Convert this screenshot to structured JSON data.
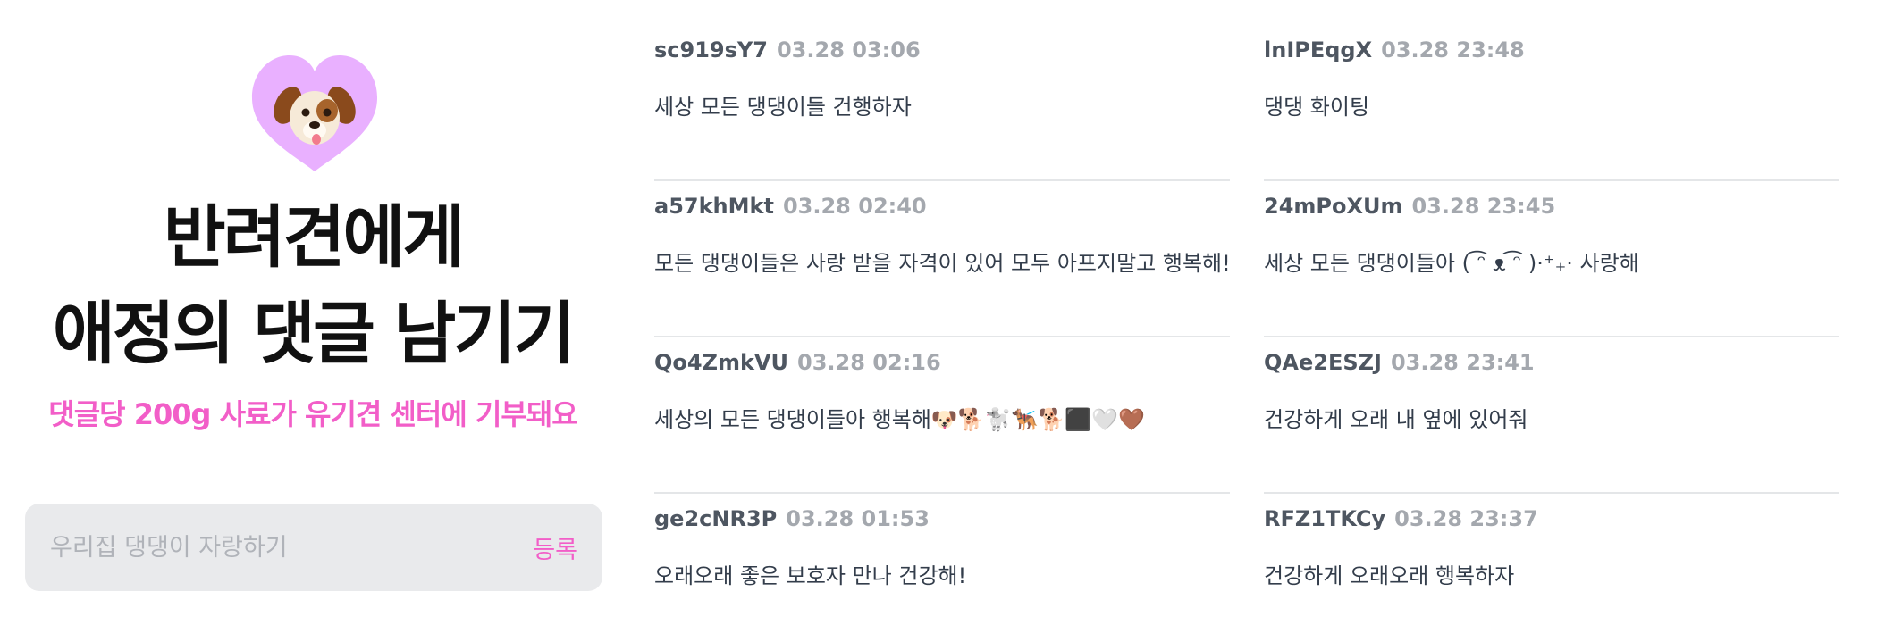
{
  "hero": {
    "icon": "dog-face-icon",
    "title_line1": "반려견에게",
    "title_line2": "애정의 댓글 남기기",
    "subtitle": "댓글당 200g 사료가 유기견 센터에 기부돼요"
  },
  "form": {
    "placeholder": "우리집 댕댕이 자랑하기",
    "submit_label": "등록"
  },
  "colors": {
    "accent": "#f25ec8",
    "heart": "#e9b0ff"
  },
  "comments": {
    "left": [
      {
        "user": "sc919sY7",
        "time": "03.28 03:06",
        "text": "세상 모든 댕댕이들 건행하자"
      },
      {
        "user": "a57khMkt",
        "time": "03.28 02:40",
        "text": "모든 댕댕이들은 사랑 받을 자격이 있어 모두 아프지말고 행복해!"
      },
      {
        "user": "Qo4ZmkVU",
        "time": "03.28 02:16",
        "text": "세상의 모든 댕댕이들아 행복해🐶🐕🐩🐕‍🦺🐕‍⬛🤍🤎"
      },
      {
        "user": "ge2cNR3P",
        "time": "03.28 01:53",
        "text": "오래오래 좋은 보호자 만나 건강해!"
      }
    ],
    "right": [
      {
        "user": "lnIPEqgX",
        "time": "03.28 23:48",
        "text": "댕댕 화이팅"
      },
      {
        "user": "24mPoXUm",
        "time": "03.28 23:45",
        "text": "세상 모든 댕댕이들아 ( ͡ᵔ ᴥ ͡ᵔ )·⁺₊· 사랑해"
      },
      {
        "user": "QAe2ESZJ",
        "time": "03.28 23:41",
        "text": "건강하게 오래 내 옆에 있어줘"
      },
      {
        "user": "RFZ1TKCy",
        "time": "03.28 23:37",
        "text": "건강하게 오래오래 행복하자"
      }
    ]
  }
}
